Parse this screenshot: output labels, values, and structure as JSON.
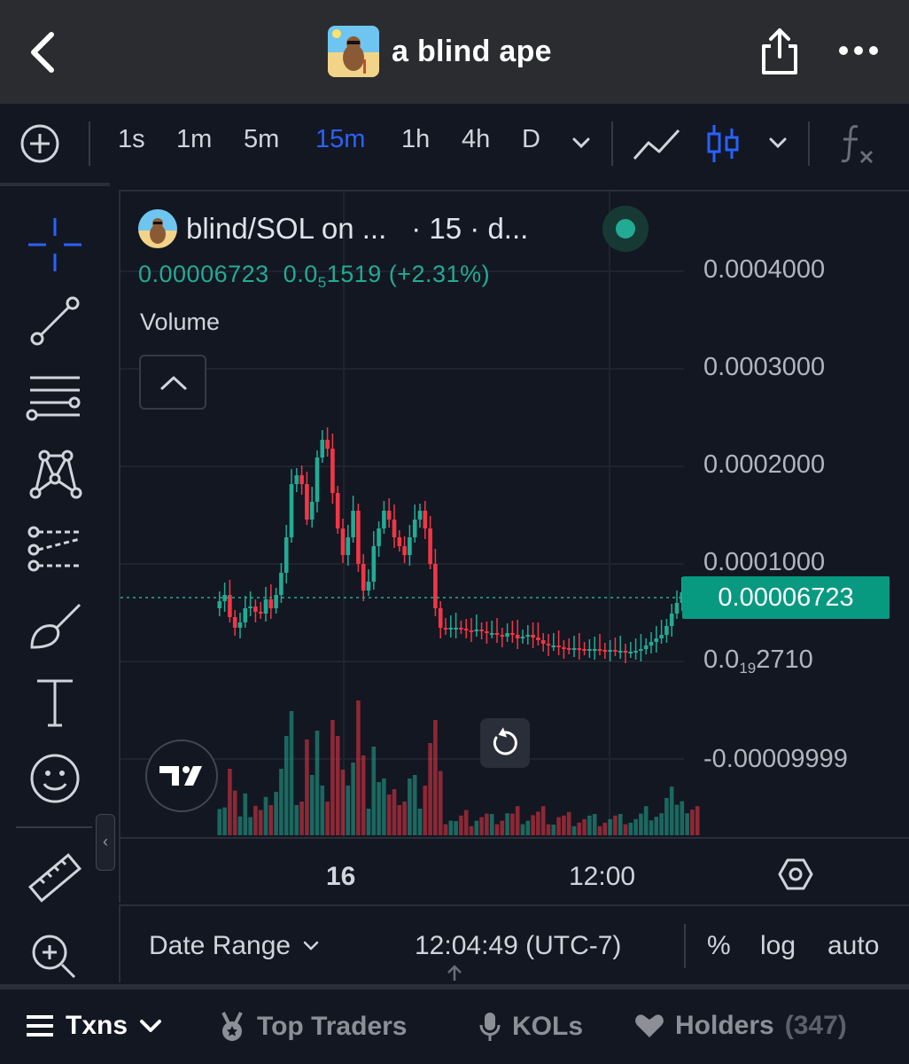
{
  "header": {
    "title": "a blind ape",
    "back_icon": "chevron-left-icon",
    "share_icon": "share-icon",
    "more_icon": "more-horizontal-icon"
  },
  "timeframes": {
    "items": [
      "1s",
      "1m",
      "5m",
      "15m",
      "1h",
      "4h",
      "D"
    ],
    "active": "15m"
  },
  "chart": {
    "legend_title": "blind/SOL on ...",
    "legend_interval": "· 15 · d...",
    "price_value": "0.00006723",
    "change_prefix": "0.0",
    "change_sub": "5",
    "change_suffix": "1519",
    "change_pct": "(+2.31%)",
    "volume_label": "Volume",
    "current_price_tag": "0.00006723",
    "y_ticks": {
      "t1": "0.0004000",
      "t2": "0.0003000",
      "t3": "0.0002000",
      "t4": "0.0001000",
      "t5_prefix": "0.0",
      "t5_sub": "19",
      "t5_suffix": "2710",
      "t6": "-0.00009999"
    },
    "x_ticks": {
      "a": "16",
      "b": "12:00"
    },
    "up_color": "#22ab94",
    "down_color": "#f23645"
  },
  "bottombar": {
    "date_range": "Date Range",
    "clock": "12:04:49 (UTC-7)",
    "percent": "%",
    "log": "log",
    "auto": "auto"
  },
  "tabs": {
    "txns": "Txns",
    "top_traders": "Top Traders",
    "kols": "KOLs",
    "holders": "Holders",
    "holders_count": "(347)"
  }
}
